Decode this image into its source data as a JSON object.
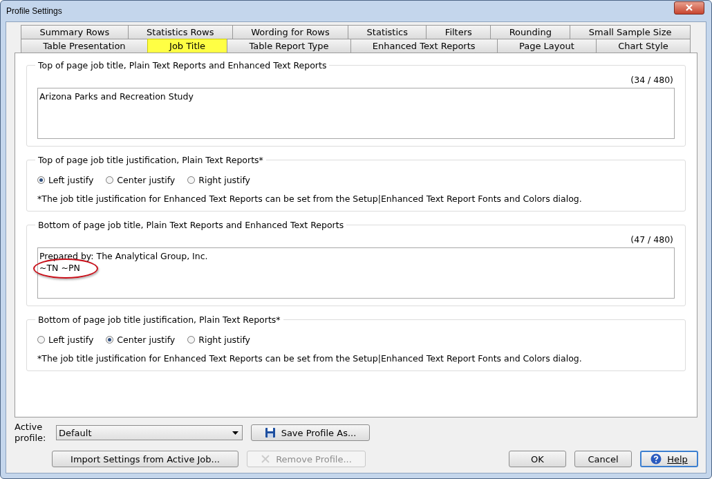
{
  "window": {
    "title": "Profile Settings"
  },
  "tab_rows": [
    [
      {
        "label": "Summary Rows",
        "selected": false
      },
      {
        "label": "Statistics Rows",
        "selected": false
      },
      {
        "label": "Wording for Rows",
        "selected": false
      },
      {
        "label": "Statistics",
        "selected": false
      },
      {
        "label": "Filters",
        "selected": false
      },
      {
        "label": "Rounding",
        "selected": false
      },
      {
        "label": "Small Sample Size",
        "selected": false
      }
    ],
    [
      {
        "label": "Table Presentation",
        "selected": false
      },
      {
        "label": "Job Title",
        "selected": true
      },
      {
        "label": "Table Report Type",
        "selected": false
      },
      {
        "label": "Enhanced Text Reports",
        "selected": false
      },
      {
        "label": "Page Layout",
        "selected": false
      },
      {
        "label": "Chart Style",
        "selected": false
      }
    ]
  ],
  "groups": [
    {
      "kind": "text",
      "title": "Top of page job title, Plain Text Reports and Enhanced Text Reports",
      "count": "(34 / 480)",
      "lines": [
        {
          "text": "Arizona Parks and Recreation Study",
          "circled": false
        }
      ]
    },
    {
      "kind": "radios",
      "title": "Top of page job title justification, Plain Text Reports*",
      "options": [
        {
          "label": "Left justify",
          "selected": true
        },
        {
          "label": "Center justify",
          "selected": false
        },
        {
          "label": "Right justify",
          "selected": false
        }
      ],
      "note": "*The job title justification for Enhanced Text Reports can be set from the Setup|Enhanced Text Report Fonts and Colors dialog."
    },
    {
      "kind": "text",
      "title": "Bottom of page job title, Plain Text Reports and Enhanced Text Reports",
      "count": "(47 / 480)",
      "lines": [
        {
          "text": "Prepared by: The Analytical Group, Inc.",
          "circled": false
        },
        {
          "text": "~TN ~PN",
          "circled": true
        }
      ]
    },
    {
      "kind": "radios",
      "title": "Bottom of page job title justification, Plain Text Reports*",
      "options": [
        {
          "label": "Left justify",
          "selected": false
        },
        {
          "label": "Center justify",
          "selected": true
        },
        {
          "label": "Right justify",
          "selected": false
        }
      ],
      "note": "*The job title justification for Enhanced Text Reports can be set from the Setup|Enhanced Text Report Fonts and Colors dialog."
    }
  ],
  "footer": {
    "profile_label": "Active profile:",
    "profile_value": "Default",
    "save_button": "Save Profile As...",
    "import_button": "Import Settings from Active Job...",
    "remove_button": {
      "label": "Remove Profile...",
      "disabled": true
    },
    "ok_button": "OK",
    "cancel_button": "Cancel",
    "help_button": "Help"
  }
}
